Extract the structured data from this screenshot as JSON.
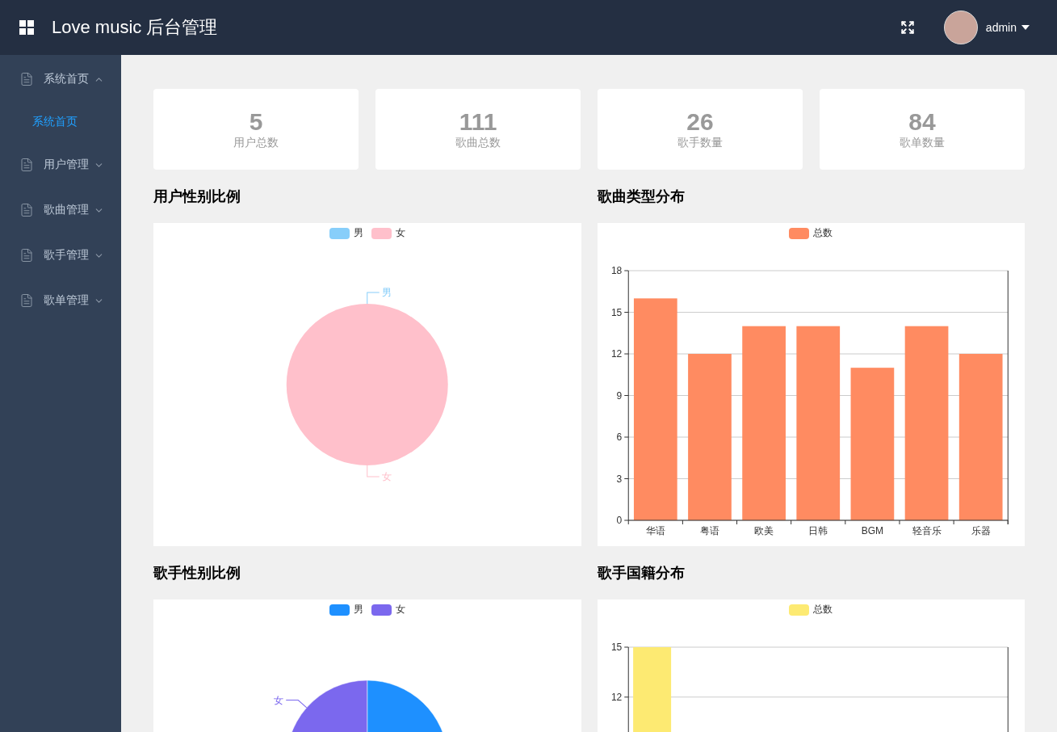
{
  "header": {
    "title": "Love music 后台管理",
    "user": "admin"
  },
  "sidebar": {
    "items": [
      {
        "label": "系统首页",
        "expanded": true,
        "children": [
          {
            "label": "系统首页",
            "selected": true
          }
        ]
      },
      {
        "label": "用户管理",
        "expanded": false
      },
      {
        "label": "歌曲管理",
        "expanded": false
      },
      {
        "label": "歌手管理",
        "expanded": false
      },
      {
        "label": "歌单管理",
        "expanded": false
      }
    ]
  },
  "stats": [
    {
      "value": "5",
      "label": "用户总数"
    },
    {
      "value": "111",
      "label": "歌曲总数"
    },
    {
      "value": "26",
      "label": "歌手数量"
    },
    {
      "value": "84",
      "label": "歌单数量"
    }
  ],
  "panels": [
    {
      "title": "用户性别比例",
      "legend": [
        {
          "label": "男",
          "color": "#87cefa",
          "slice_label": "男"
        },
        {
          "label": "女",
          "color": "#ffc0cb",
          "slice_label": "女"
        }
      ],
      "chart_data": {
        "type": "pie",
        "values": [
          0,
          100
        ]
      }
    },
    {
      "title": "歌曲类型分布",
      "chart_data": {
        "type": "bar",
        "categories": [
          "华语",
          "粤语",
          "欧美",
          "日韩",
          "BGM",
          "轻音乐",
          "乐器"
        ],
        "series": [
          {
            "name": "总数",
            "color": "#ff8b61",
            "values": [
              16,
              12,
              14,
              14,
              11,
              14,
              12
            ]
          }
        ],
        "ylim": [
          0,
          18
        ],
        "yticks": [
          0,
          3,
          6,
          9,
          12,
          15,
          18
        ],
        "grid": true
      }
    },
    {
      "title": "歌手性别比例",
      "legend": [
        {
          "label": "男",
          "color": "#1e90ff"
        },
        {
          "label": "女",
          "color": "#7b68ee",
          "slice_label": "女"
        }
      ],
      "chart_data": {
        "type": "pie",
        "values": [
          73,
          27
        ]
      }
    },
    {
      "title": "歌手国籍分布",
      "chart_data": {
        "type": "bar",
        "series": [
          {
            "name": "总数",
            "color": "#fdea72",
            "values": [
              15
            ]
          }
        ],
        "ylim": [
          0,
          15
        ],
        "yticks": [
          12,
          15
        ],
        "grid": true
      }
    }
  ]
}
